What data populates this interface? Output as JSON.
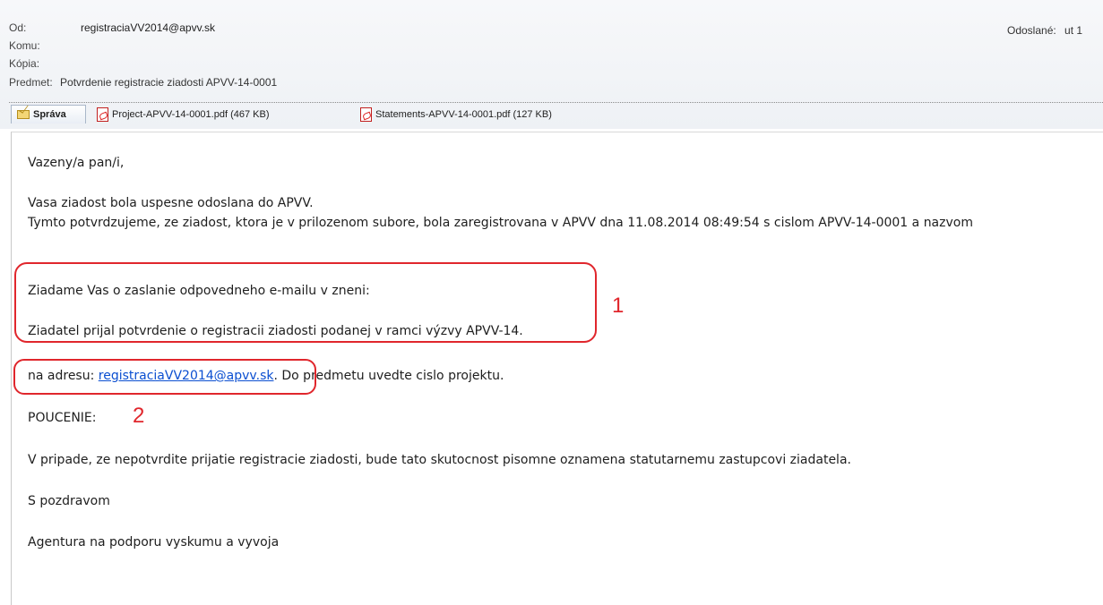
{
  "header": {
    "from_label": "Od:",
    "from_value": "registraciaVV2014@apvv.sk",
    "to_label": "Komu:",
    "cc_label": "Kópia:",
    "subject_label": "Predmet:",
    "subject_value": "Potvrdenie registracie ziadosti APVV-14-0001",
    "sent_label": "Odoslané:",
    "sent_value": "ut 1"
  },
  "tabs": {
    "message_label": "Správa",
    "attachments": [
      {
        "name": "Project-APVV-14-0001.pdf (467 KB)",
        "icon": "pdf-icon"
      },
      {
        "name": "Statements-APVV-14-0001.pdf (127 KB)",
        "icon": "pdf-icon"
      }
    ]
  },
  "body": {
    "greeting": "Vazeny/a pan/i,",
    "line1": "Vasa ziadost bola uspesne odoslana do APVV.",
    "line2": "Tymto potvrdzujeme, ze ziadost, ktora je v prilozenom subore, bola zaregistrovana v APVV dna 11.08.2014 08:49:54 s cislom APVV-14-0001 a nazvom",
    "request": "Ziadame Vas o zaslanie odpovedneho e-mailu v zneni:",
    "quote": "Ziadatel prijal potvrdenie o registracii ziadosti podanej v ramci výzvy APVV-14.",
    "address_prefix": "na adresu: ",
    "address_link": "registraciaVV2014@apvv.sk",
    "address_suffix": ". Do predmetu uvedte cislo projektu.",
    "notice_heading": "POUCENIE:",
    "notice_text": "V pripade, ze nepotvrdite prijatie registracie ziadosti, bude tato skutocnost pisomne oznamena statutarnemu zastupcovi ziadatela.",
    "closing": "S pozdravom",
    "signature": "Agentura na podporu vyskumu a vyvoja"
  },
  "annotations": {
    "callout1_number": "1",
    "callout2_number": "2",
    "color": "#e0262c"
  }
}
